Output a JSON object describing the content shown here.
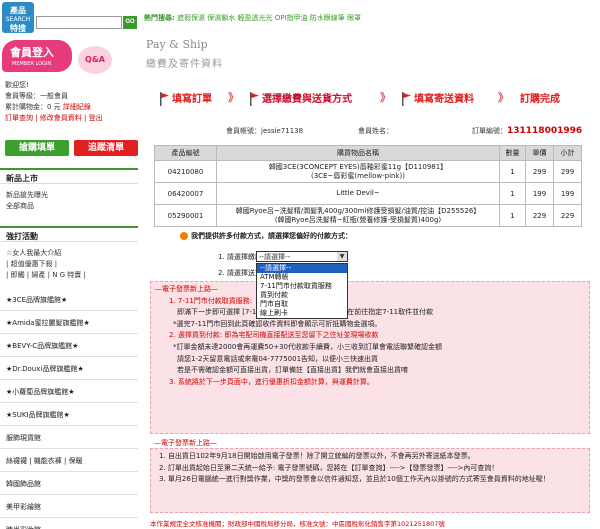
{
  "sidebar": {
    "logo": {
      "line1": "產品",
      "line2": "SEARCH",
      "line3": "特搜"
    },
    "search": {
      "value": "",
      "go_label": "GO"
    },
    "member": {
      "banner": "會員登入",
      "banner_sub": "MEMBER LOGIN",
      "qa": "Q&A",
      "welcome": "歡迎您!",
      "level": "會員等級：一般會員",
      "bonus": "累計購物金：0 元",
      "bonus_link": "詳細紀錄",
      "links": "訂單查詢 | 修改會員資料 | 登出"
    },
    "buy_button": "搶購填單",
    "cart_button": "追蹤清單",
    "new_section": "新品上市",
    "new_items": [
      "新品搶先曝光",
      "全部商品"
    ],
    "promo_section": "強打活動",
    "promo_items": [
      "☆女人我最大介紹",
      "| 超值優惠下殺 |",
      "| 即觸 | 婦產 | N G 特賣 |"
    ],
    "categories": [
      "★3CE品牌旗艦館★",
      "★Amida蜜拉麗髮旗艦館★",
      "★BEVY-C品牌旗艦館★",
      "★Dr.Douxi品牌旗艦館★",
      "★小蘿蔔品牌旗艦館★",
      "★SUKI品牌旗艦館★",
      "服飾現貨館",
      "絲襪襪 | 機能衣褲 | 保暖",
      "韓國飾品館",
      "美甲彩繪館",
      "時尚彩妝館"
    ]
  },
  "main": {
    "hot_label": "熱門搜尋:",
    "hot_terms": "遮瑕保濕 保濕鎖水 輕盈透光光 OPI指甲油 防水眼線筆 眼罩",
    "title": "Pay & Ship",
    "subtitle": "繳費及寄件資料",
    "steps": [
      "填寫訂單",
      "選擇繳費與送貨方式",
      "填寫寄送資料",
      "訂購完成"
    ],
    "step_arrow": "》",
    "order": {
      "account_label": "會員帳號：",
      "account": "jessie71138",
      "name_label": "會員姓名：",
      "name": "",
      "number_label": "訂單編號：",
      "number": "131118001996"
    },
    "table": {
      "headers": [
        "產品編號",
        "購買物品名稱",
        "數量",
        "單價",
        "小計"
      ],
      "rows": [
        {
          "id": "04210080",
          "name1": "韓國3CE(3CONCEPT EYES)唇釉彩蜜11g【D110981】",
          "name2": "(3CE~唇彩蜜(mellow-pink))",
          "qty": "1",
          "price": "299",
          "subtotal": "299"
        },
        {
          "id": "06420007",
          "name1": "Little Devil~",
          "name2": "",
          "qty": "1",
          "price": "199",
          "subtotal": "199"
        },
        {
          "id": "05290001",
          "name1": "韓國Ryoe呂~洗髮精/潤髮乳400g/300ml修護受損髮/油質/控油【D255526】",
          "name2": "(韓國Ryoe呂洗髮精~紅瓶(營養修護-受損髮質)400g)",
          "qty": "1",
          "price": "229",
          "subtotal": "229"
        }
      ]
    },
    "pay": {
      "heading": "我們提供許多付款方式，請選擇您偏好的付款方式：",
      "row1_label": "1. 請選擇繳款方式：",
      "row2_label": "2. 請選擇送貨方式：",
      "selected": "--請選擇--",
      "options": [
        "--請選擇--",
        "ATM轉帳",
        "7-11門市付款取貨服務",
        "貨到付款",
        "門市自取",
        "線上刷卡"
      ]
    },
    "notice1": {
      "header": "—電子發票新上路—",
      "lines": [
        "1. 7-11門市付款取貨服務:",
        "即滿下一步即可選擇 [7-11] 門市完畢後 小三幫您出貨 在前往指定7-11取件並付款",
        "*選完7-11門市回到此頁確認收件資料即會顯示可折抵購物金選項。",
        "2. 選擇貨到付款: 即為宅配司機直接配送至您留下之住址並現場收款",
        "*訂單金額未達2000會再運費50+30代收款手續費，小三收到訂單會電話聯繫確認金額",
        "請您1-2天留意電話或來電04-7775001告知，以便小三快速出貨",
        "若是不需確認金額可直接出貨，訂單備註【直接出貨】我們就會直接出貨唷",
        "3. 系統將於下一步頁面中，進行優惠折扣金額計算，與運費計算。"
      ]
    },
    "notice2": {
      "header": "—電子發票新上路—",
      "lines": [
        "1. 自出貨日102年9月18日開始啟用電子發票！除了開立統編的發票以外，不會再另外寄送紙本發票。",
        "2. 訂單出貨起始日至第二天統一給予: 電子發票號碼，您將在【訂單查詢】---->【發票發票】---->內可查詢！",
        "3. 單月26日電腦統一進行對獎作業，中獎的發票會以信件通知您，並且於10個工作天內以掛號的方式寄至會員資料的地址喔！"
      ],
      "footnote": "本作業規定全文核准機關；財政部中國稅局移分局，核准文號：中區國稅彰化銷售字第1021251807號"
    }
  }
}
